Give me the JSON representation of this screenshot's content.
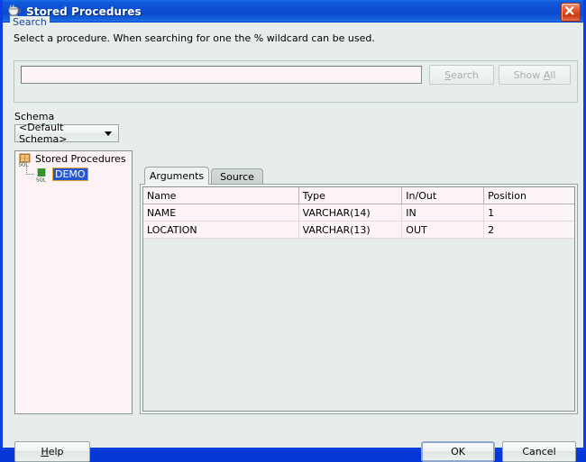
{
  "window": {
    "title": "Stored Procedures",
    "icon": "java-coffee-cup-icon",
    "close_label": "×"
  },
  "instruction": "Select a procedure. When searching for one the % wildcard can be used.",
  "search": {
    "legend": "Search",
    "value": "",
    "placeholder": "",
    "buttons": {
      "search": {
        "label": "Search",
        "mnemonic": "S",
        "enabled": false
      },
      "show_all": {
        "label": "Show All",
        "mnemonic": "A",
        "enabled": false
      }
    }
  },
  "schema": {
    "label": "Schema",
    "selected": "<Default Schema>",
    "options": [
      "<Default Schema>"
    ]
  },
  "tree": {
    "root": {
      "label": "Stored Procedures",
      "icon": "stored-procedures-folder-icon"
    },
    "children": [
      {
        "label": "DEMO",
        "icon": "procedure-sql-icon",
        "selected": true
      }
    ]
  },
  "tabs": [
    {
      "label": "Arguments",
      "active": true
    },
    {
      "label": "Source",
      "active": false
    }
  ],
  "table": {
    "columns": [
      "Name",
      "Type",
      "In/Out",
      "Position"
    ],
    "rows": [
      [
        "NAME",
        "VARCHAR(14)",
        "IN",
        "1"
      ],
      [
        "LOCATION",
        "VARCHAR(13)",
        "OUT",
        "2"
      ]
    ]
  },
  "footer": {
    "help": {
      "label": "Help",
      "mnemonic": "H"
    },
    "ok": {
      "label": "OK",
      "focused": true
    },
    "cancel": {
      "label": "Cancel"
    }
  },
  "colors": {
    "titlebar_blue": "#0c4ed3",
    "frame_blue": "#0a3fe0",
    "dialog_bg": "#e7edeb",
    "field_bg": "#fdf4f6",
    "selection_blue": "#2456d6",
    "selection_border": "#e89a33",
    "legend_text": "#22459c",
    "close_red": "#c93a12"
  }
}
